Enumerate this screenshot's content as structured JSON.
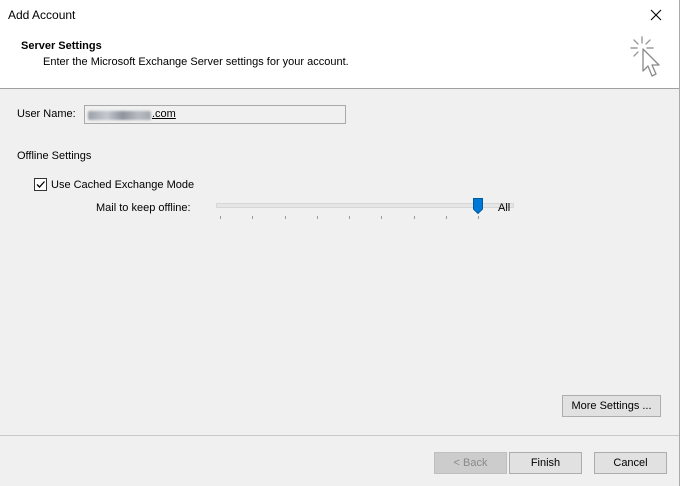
{
  "window": {
    "title": "Add Account",
    "close_icon": "close-icon"
  },
  "header": {
    "title": "Server Settings",
    "subtitle": "Enter the Microsoft Exchange Server settings for your account.",
    "icon": "cursor-sparkle-icon"
  },
  "form": {
    "username_label": "User Name:",
    "username_value_visible_suffix": ".com",
    "offline_section_label": "Offline Settings",
    "cached_mode_label": "Use Cached Exchange Mode",
    "cached_mode_checked": true,
    "mail_offline_label": "Mail to keep offline:",
    "mail_offline_value": "All",
    "mail_offline_level_fraction": 1.0
  },
  "buttons": {
    "more_settings": "More Settings ...",
    "back": "< Back",
    "finish": "Finish",
    "cancel": "Cancel"
  }
}
